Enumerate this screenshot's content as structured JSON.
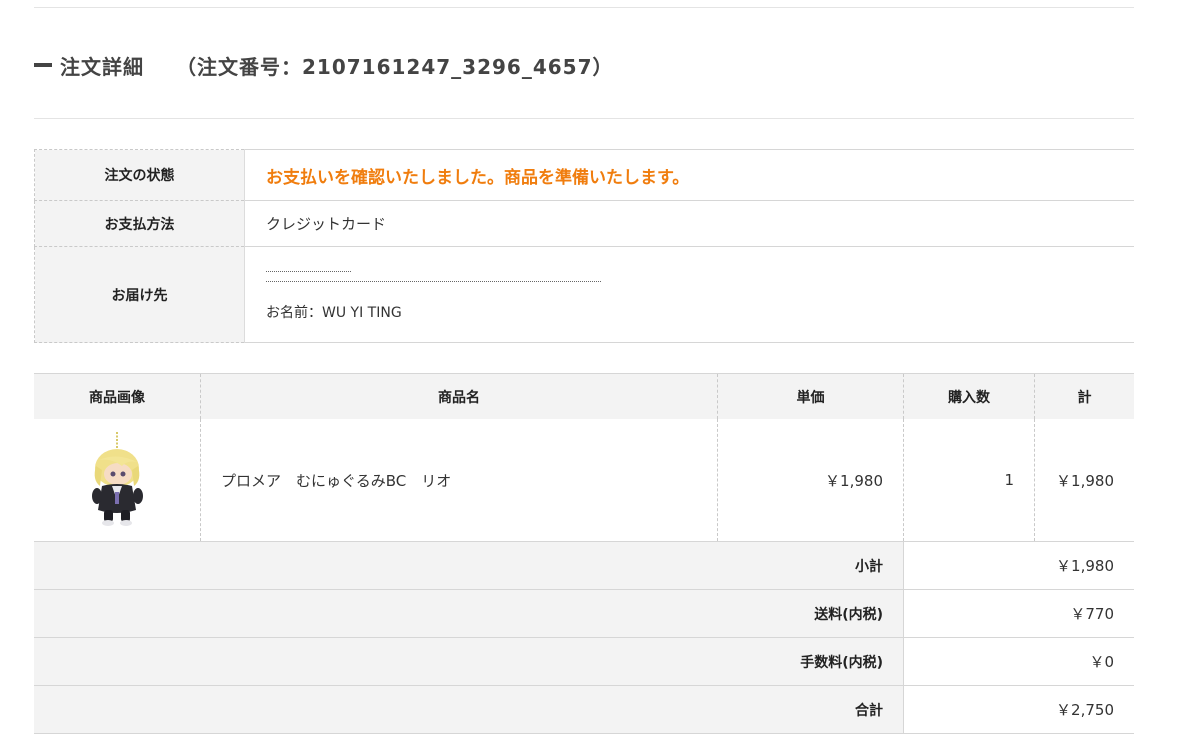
{
  "order": {
    "title": "注文詳細",
    "number_text": "（注文番号：2107161247_3296_4657）"
  },
  "info": {
    "status_label": "注文の状態",
    "status_value": "お支払いを確認いたしました。商品を準備いたします。",
    "payment_label": "お支払方法",
    "payment_value": "クレジットカード",
    "delivery_label": "お届け先",
    "delivery_name": "お名前：WU YI TING"
  },
  "items_table": {
    "headers": [
      "商品画像",
      "商品名",
      "単価",
      "購入数",
      "計"
    ],
    "rows": [
      {
        "image_icon": "plush-keychain-image",
        "name": "プロメア　むにゅぐるみBC　リオ",
        "unit_price": "￥1,980",
        "quantity": "1",
        "total": "￥1,980"
      }
    ]
  },
  "summary": [
    {
      "label": "小計",
      "value": "￥1,980"
    },
    {
      "label": "送料(内税)",
      "value": "￥770"
    },
    {
      "label": "手数料(内税)",
      "value": "￥0"
    },
    {
      "label": "合計",
      "value": "￥2,750"
    }
  ],
  "colors": {
    "status_accent": "#f07d0e",
    "header_bg": "#f3f3f3"
  }
}
